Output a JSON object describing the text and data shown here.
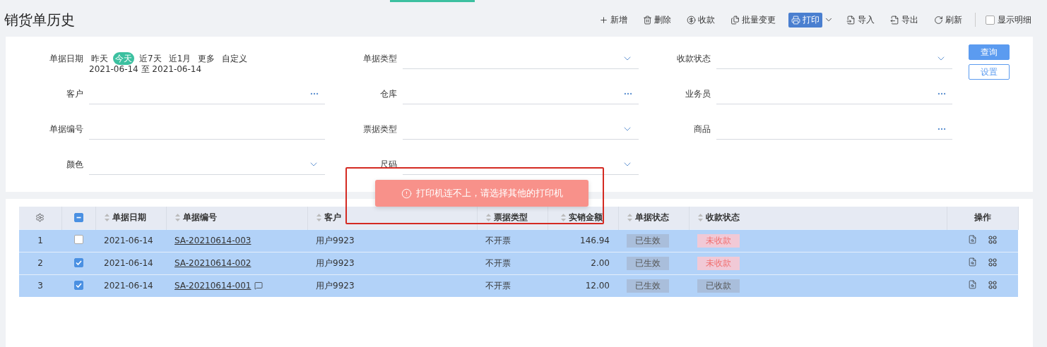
{
  "page": {
    "title": "销货单历史"
  },
  "toolbar": {
    "buttons": [
      {
        "label": "新增",
        "kind": "add"
      },
      {
        "label": "删除",
        "kind": "delete"
      },
      {
        "label": "收款",
        "kind": "receive"
      },
      {
        "label": "批量变更",
        "kind": "batch"
      },
      {
        "label": "打印",
        "kind": "print"
      },
      {
        "label": "导入",
        "kind": "import"
      },
      {
        "label": "导出",
        "kind": "export"
      },
      {
        "label": "刷新",
        "kind": "refresh"
      }
    ],
    "show_detail": {
      "label": "显示明细",
      "checked": false
    }
  },
  "filters": {
    "date": {
      "label": "单据日期",
      "presets": [
        {
          "label": "昨天",
          "selected": false
        },
        {
          "label": "今天",
          "selected": true
        },
        {
          "label": "近7天",
          "selected": false
        },
        {
          "label": "近1月",
          "selected": false
        },
        {
          "label": "更多",
          "selected": false
        },
        {
          "label": "自定义",
          "selected": false
        }
      ],
      "range": "2021-06-14 至 2021-06-14"
    },
    "fields": [
      {
        "label": "单据类型",
        "kind": "select"
      },
      {
        "label": "收款状态",
        "kind": "select"
      },
      {
        "label": "客户",
        "kind": "lookup"
      },
      {
        "label": "仓库",
        "kind": "lookup"
      },
      {
        "label": "业务员",
        "kind": "lookup"
      },
      {
        "label": "单据编号",
        "kind": "text"
      },
      {
        "label": "票据类型",
        "kind": "select"
      },
      {
        "label": "商品",
        "kind": "lookup"
      },
      {
        "label": "颜色",
        "kind": "select"
      },
      {
        "label": "尺码",
        "kind": "select"
      }
    ],
    "buttons": [
      {
        "label": "查询",
        "kind": "primary"
      },
      {
        "label": "设置",
        "kind": "outline"
      }
    ]
  },
  "table": {
    "header_checkbox": {
      "indeterminate": true
    },
    "columns": [
      {
        "label": "单据日期",
        "sortable": true
      },
      {
        "label": "单据编号",
        "sortable": true
      },
      {
        "label": "客户",
        "sortable": true
      },
      {
        "label": "票据类型",
        "sortable": true
      },
      {
        "label": "实销金额",
        "sortable": true
      },
      {
        "label": "单据状态",
        "sortable": true
      },
      {
        "label": "收款状态",
        "sortable": true
      },
      {
        "label": "操作",
        "sortable": false
      }
    ],
    "rows": [
      {
        "index": "1",
        "checked": false,
        "date": "2021-06-14",
        "code": "SA-20210614-003",
        "has_note": false,
        "customer": "用户9923",
        "invoice_type": "不开票",
        "amount": "146.94",
        "status": "已生效",
        "payment": {
          "label": "未收款",
          "kind": "unpaid"
        }
      },
      {
        "index": "2",
        "checked": true,
        "date": "2021-06-14",
        "code": "SA-20210614-002",
        "has_note": false,
        "customer": "用户9923",
        "invoice_type": "不开票",
        "amount": "2.00",
        "status": "已生效",
        "payment": {
          "label": "未收款",
          "kind": "unpaid"
        }
      },
      {
        "index": "3",
        "checked": true,
        "date": "2021-06-14",
        "code": "SA-20210614-001",
        "has_note": true,
        "customer": "用户9923",
        "invoice_type": "不开票",
        "amount": "12.00",
        "status": "已生效",
        "payment": {
          "label": "已收款",
          "kind": "paid"
        }
      }
    ]
  },
  "toast": {
    "message": "打印机连不上，请选择其他的打印机"
  }
}
